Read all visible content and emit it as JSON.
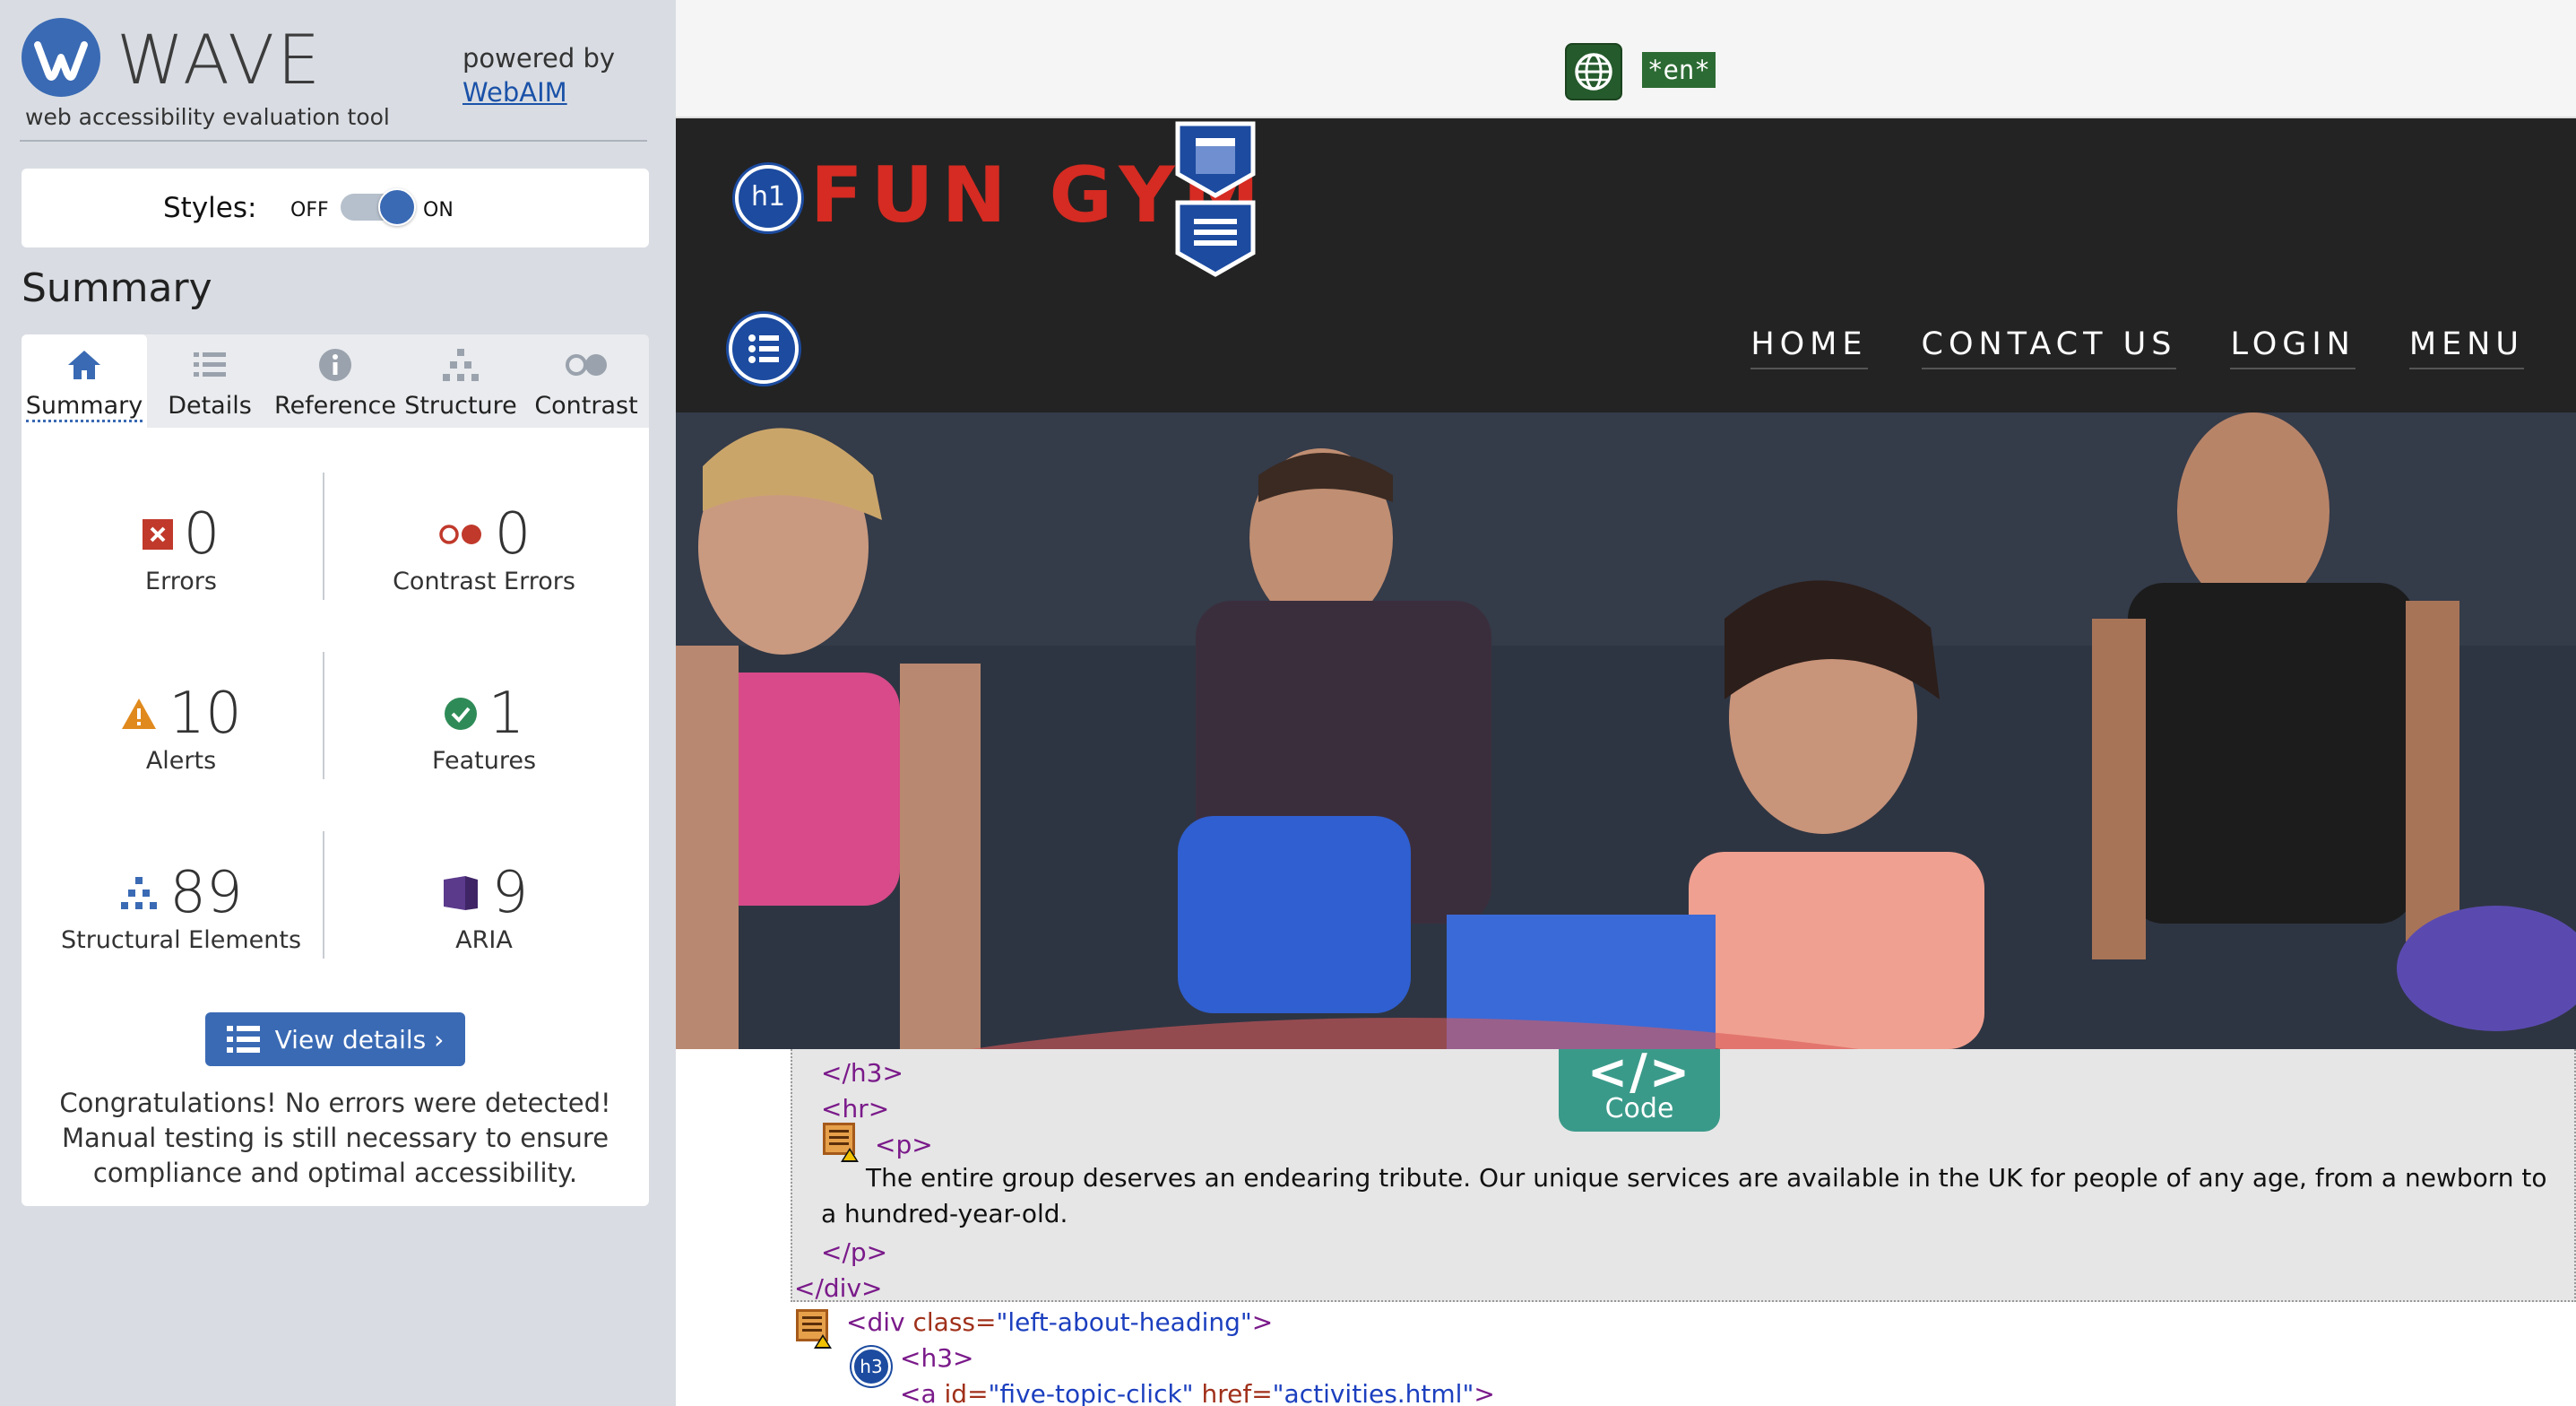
{
  "wave": {
    "title": "WAVE",
    "subtitle": "web accessibility evaluation tool",
    "powered_by": "powered by",
    "webaim_link": "WebAIM",
    "styles_label": "Styles:",
    "toggle_off": "OFF",
    "toggle_on": "ON",
    "toggle_state": "on",
    "summary_heading": "Summary",
    "tabs": [
      {
        "label": "Summary",
        "icon": "home-icon",
        "active": true
      },
      {
        "label": "Details",
        "icon": "list-icon",
        "active": false
      },
      {
        "label": "Reference",
        "icon": "info-icon",
        "active": false
      },
      {
        "label": "Structure",
        "icon": "hierarchy-icon",
        "active": false
      },
      {
        "label": "Contrast",
        "icon": "contrast-icon",
        "active": false
      }
    ],
    "stats": {
      "errors": {
        "value": "0",
        "label": "Errors",
        "icon": "error-icon",
        "color": "#c0392b"
      },
      "contrast_errors": {
        "value": "0",
        "label": "Contrast Errors",
        "icon": "contrast-error-icon",
        "color": "#c0392b"
      },
      "alerts": {
        "value": "10",
        "label": "Alerts",
        "icon": "alert-icon",
        "color": "#e08a1e"
      },
      "features": {
        "value": "1",
        "label": "Features",
        "icon": "feature-icon",
        "color": "#2e8b57"
      },
      "structural": {
        "value": "89",
        "label": "Structural Elements",
        "icon": "structure-icon",
        "color": "#3a6ab4"
      },
      "aria": {
        "value": "9",
        "label": "ARIA",
        "icon": "aria-icon",
        "color": "#5b3a8c"
      }
    },
    "view_details": "View details ›",
    "congrats": "Congratulations! No errors were detected! Manual testing is still necessary to ensure compliance and optimal accessibility."
  },
  "site": {
    "lang_tag": "*en*",
    "h1_badge": "h1",
    "brand": "FUN GYM",
    "nav": [
      "HOME",
      "CONTACT US",
      "LOGIN",
      "MENU"
    ],
    "code_tab_glyph": "</>",
    "code_tab_label": "Code",
    "h3_badge": "h3",
    "code": {
      "close_h3": "</h3>",
      "hr": "<hr>",
      "open_p": "<p>",
      "paragraph": "The entire group deserves an endearing tribute. Our unique services are available in the UK for people of any age, from a newborn to a hundred-year-old.",
      "close_p": "</p>",
      "close_div": "</div>",
      "div_open_tag": "<div",
      "div_attr": "class=",
      "div_val": "\"left-about-heading\"",
      "div_close_bracket": ">",
      "open_h3": "<h3>",
      "a_open": "<a",
      "a_id_attr": "id=",
      "a_id_val": "\"five-topic-click\"",
      "a_href_attr": "href=",
      "a_href_val": "\"activities.html\"",
      "a_close": ">"
    }
  }
}
